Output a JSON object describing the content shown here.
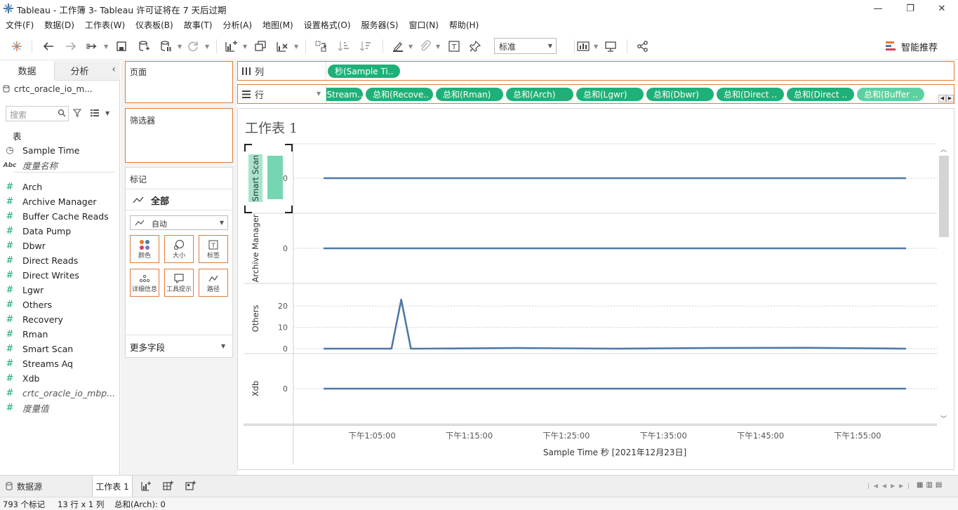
{
  "window": {
    "title": "Tableau - 工作簿 3- Tableau 许可证将在 7 天后过期"
  },
  "menu": [
    "文件(F)",
    "数据(D)",
    "工作表(W)",
    "仪表板(B)",
    "故事(T)",
    "分析(A)",
    "地图(M)",
    "设置格式(O)",
    "服务器(S)",
    "窗口(N)",
    "帮助(H)"
  ],
  "toolbar": {
    "fit_select": "标准",
    "smart_recommend": "智能推荐"
  },
  "datapane": {
    "tab_data": "数据",
    "tab_analysis": "分析",
    "datasource": "crtc_oracle_io_m...",
    "search_placeholder": "搜索",
    "section_tables": "表",
    "fields": [
      {
        "type": "date",
        "name": "Sample Time"
      },
      {
        "type": "abc",
        "name": "度量名称",
        "italic": true
      },
      {
        "type": "num",
        "name": "Arch"
      },
      {
        "type": "num",
        "name": "Archive Manager"
      },
      {
        "type": "num",
        "name": "Buffer Cache Reads"
      },
      {
        "type": "num",
        "name": "Data Pump"
      },
      {
        "type": "num",
        "name": "Dbwr"
      },
      {
        "type": "num",
        "name": "Direct Reads"
      },
      {
        "type": "num",
        "name": "Direct Writes"
      },
      {
        "type": "num",
        "name": "Lgwr"
      },
      {
        "type": "num",
        "name": "Others"
      },
      {
        "type": "num",
        "name": "Recovery"
      },
      {
        "type": "num",
        "name": "Rman"
      },
      {
        "type": "num",
        "name": "Smart Scan"
      },
      {
        "type": "num",
        "name": "Streams Aq"
      },
      {
        "type": "num",
        "name": "Xdb"
      },
      {
        "type": "num",
        "name": "crtc_oracle_io_mbp...",
        "italic": true
      },
      {
        "type": "num",
        "name": "度量值",
        "italic": true
      }
    ]
  },
  "shelves": {
    "pages": "页面",
    "filters": "筛选器",
    "columns_label": "列",
    "rows_label": "行",
    "columns_pills": [
      "秒(Sample Ti.."
    ],
    "rows_pills": [
      "(Stream..",
      "总和(Recove..",
      "总和(Rman)",
      "总和(Arch)",
      "总和(Lgwr)",
      "总和(Dbwr)",
      "总和(Direct ..",
      "总和(Direct ..",
      "总和(Buffer .."
    ]
  },
  "marks": {
    "title": "标记",
    "all": "全部",
    "type": "自动",
    "buttons": [
      "颜色",
      "大小",
      "标签",
      "详细信息",
      "工具提示",
      "路径"
    ],
    "more_fields": "更多字段"
  },
  "view": {
    "title": "工作表 1"
  },
  "chart_data": {
    "type": "line",
    "title": "工作表 1",
    "xlabel": "Sample Time 秒 [2021年12月23日]",
    "x_ticks": [
      "下午1:05:00",
      "下午1:15:00",
      "下午1:25:00",
      "下午1:35:00",
      "下午1:45:00",
      "下午1:55:00"
    ],
    "color": "#4e79a7",
    "panes": [
      {
        "name": "Smart Scan",
        "y_ticks": [
          0
        ],
        "values_desc": "constant",
        "values": [
          0,
          0
        ]
      },
      {
        "name": "Archive Manager",
        "y_ticks": [
          0
        ],
        "values": [
          0,
          0
        ]
      },
      {
        "name": "Others",
        "y_ticks": [
          0,
          10,
          20
        ],
        "ylim": [
          0,
          25
        ],
        "x_minutes": [
          0,
          7,
          8,
          9,
          10,
          20,
          30,
          40,
          50,
          60
        ],
        "values": [
          0,
          0,
          23,
          0,
          0,
          0.3,
          0,
          0.3,
          0.4,
          0
        ]
      },
      {
        "name": "Xdb",
        "y_ticks": [
          0
        ],
        "values": [
          0,
          0
        ]
      }
    ]
  },
  "sheets": {
    "datasource_tab": "数据源",
    "sheet_tab": "工作表 1"
  },
  "status": {
    "marks": "793 个标记",
    "rows_cols": "13 行 x 1 列",
    "sum": "总和(Arch): 0"
  }
}
